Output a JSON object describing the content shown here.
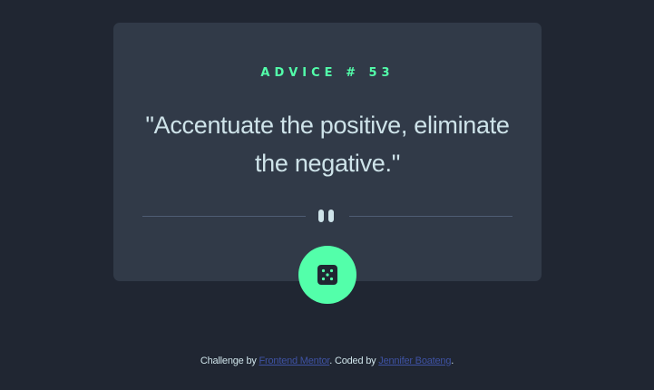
{
  "card": {
    "advice_label": "ADVICE # 53",
    "quote": "\"Accentuate the positive, eliminate the negative.\""
  },
  "footer": {
    "prefix": "Challenge by ",
    "challenge_link": "Frontend Mentor",
    "middle": ". Coded by ",
    "author_link": "Jennifer Boateng",
    "suffix": "."
  },
  "icons": {
    "divider_icon": "pause-icon",
    "button_icon": "dice-icon"
  },
  "colors": {
    "background": "#202632",
    "card": "#313a48",
    "accent": "#53ffaa",
    "text": "#cee3e9",
    "link": "#3e52a3"
  }
}
